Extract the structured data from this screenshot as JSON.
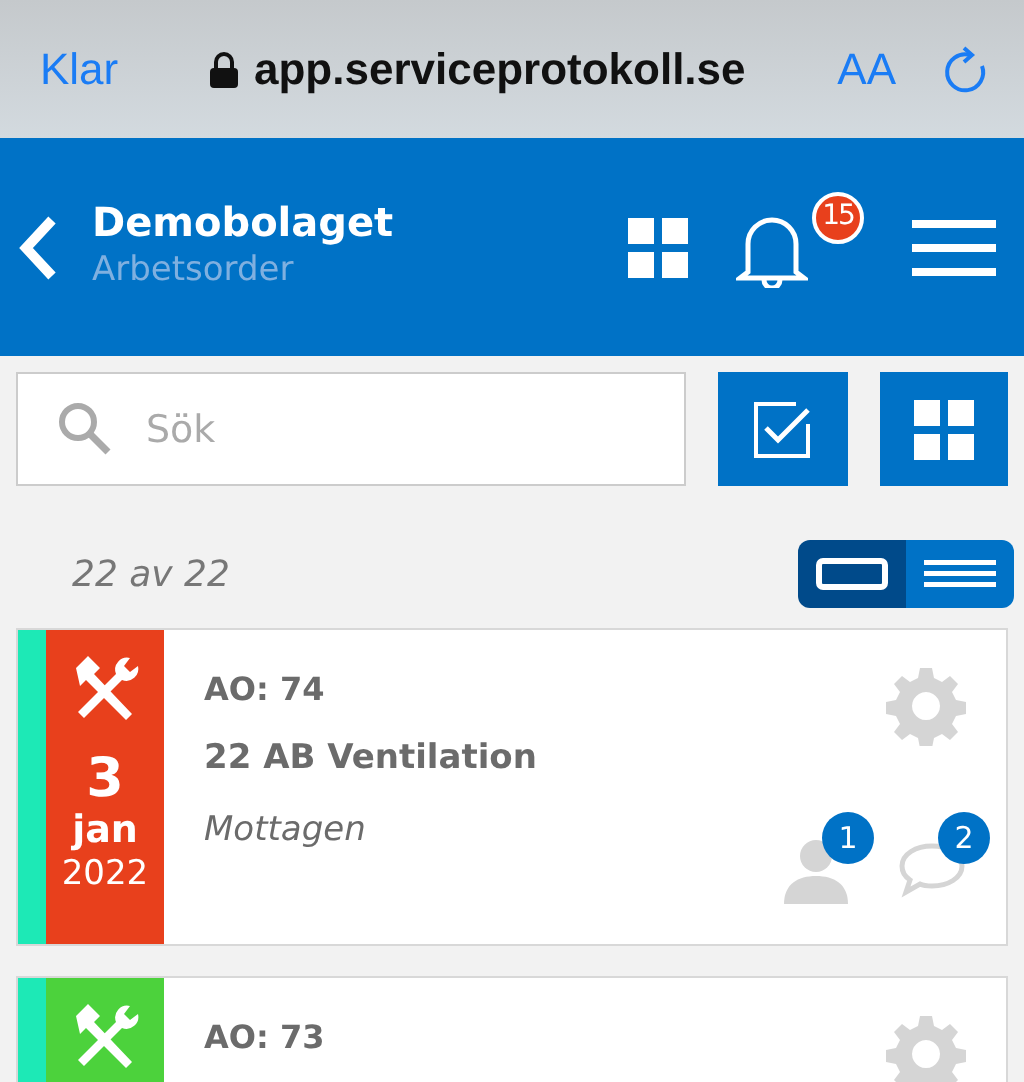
{
  "browser": {
    "done": "Klar",
    "url": "app.serviceprotokoll.se",
    "text_size": "AA"
  },
  "header": {
    "title": "Demobolaget",
    "subtitle": "Arbetsorder",
    "notifications": "15"
  },
  "search": {
    "placeholder": "Sök"
  },
  "count": "22 av 22",
  "view_modes": [
    {
      "kind": "card",
      "selected": true
    },
    {
      "kind": "list",
      "selected": false
    }
  ],
  "orders": [
    {
      "stripe": {
        "color": "#1de9b6"
      },
      "color": "#e8401c",
      "day": "3",
      "month": "jan",
      "year": "2022",
      "number": "AO: 74",
      "title": "22 AB Ventilation",
      "status": "Mottagen",
      "contacts": "1",
      "comments": "2"
    },
    {
      "stripe": {
        "color": "#1de9b6"
      },
      "color": "#4cd23c",
      "number": "AO: 73"
    }
  ]
}
